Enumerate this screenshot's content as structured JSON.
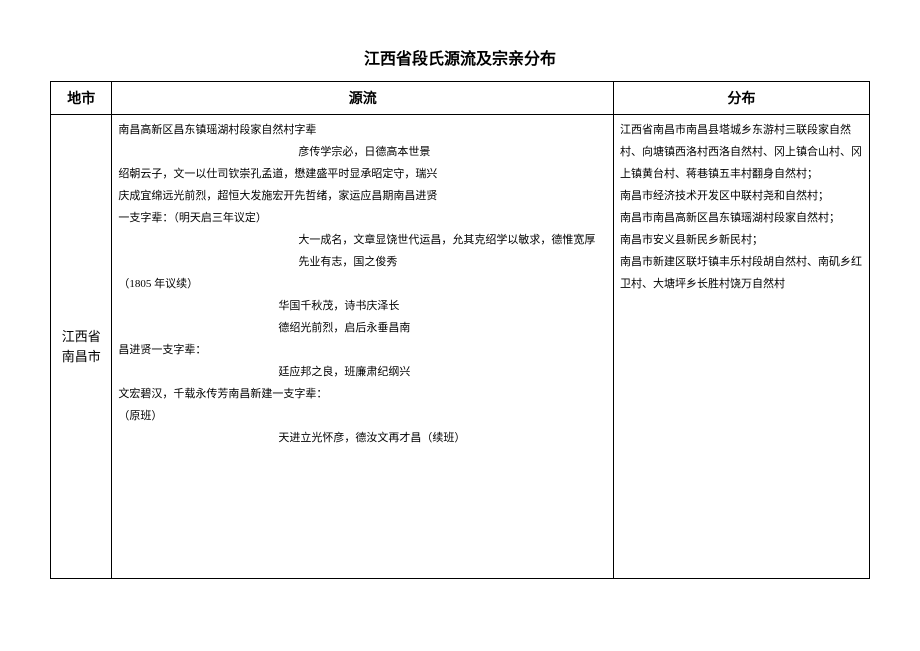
{
  "title": "江西省段氏源流及宗亲分布",
  "headers": {
    "city": "地市",
    "origin": "源流",
    "distribution": "分布"
  },
  "row": {
    "city": "江西省南昌市",
    "origin": {
      "l1": "南昌高新区昌东镇瑶湖村段家自然村字辈",
      "l2": "彦传学宗必，日德高本世景",
      "l3": "绍朝云子，文一以仕司钦崇孔孟道，懋建盛平时显承昭定守，瑞兴",
      "l4": "庆成宜绵远光前烈，超恒大发施宏开先哲绪，家运应昌期南昌进贤",
      "l5": "一支字辈：（明天启三年议定）",
      "l6": "大一成名，文章显饶世代运昌，允其克绍学以敏求，德惟宽厚",
      "l7": "先业有志，国之俊秀",
      "l8": "（1805 年议续）",
      "l9": "华国千秋茂，诗书庆泽长",
      "l10": "德绍光前烈，启后永垂昌南",
      "l11": "昌进贤一支字辈：",
      "l12": "廷应邦之良，班廉肃纪纲兴",
      "l13": "文宏碧汉，千载永传芳南昌新建一支字辈：",
      "l14": "（原班）",
      "l15": "天进立光怀彦，德汝文再才昌（续班）"
    },
    "distribution": {
      "d1": "江西省南昌市南昌县塔城乡东游村三联段家自然村、向塘镇西洛村西洛自然村、冈上镇合山村、冈上镇黄台村、蒋巷镇五丰村翻身自然村；",
      "d2": "南昌市经济技术开发区中联村尧和自然村；",
      "d3": "南昌市南昌高新区昌东镇瑶湖村段家自然村；",
      "d4": "南昌市安义县新民乡新民村；",
      "d5": "南昌市新建区联圩镇丰乐村段胡自然村、南矶乡红卫村、大塘坪乡长胜村饶万自然村"
    }
  }
}
